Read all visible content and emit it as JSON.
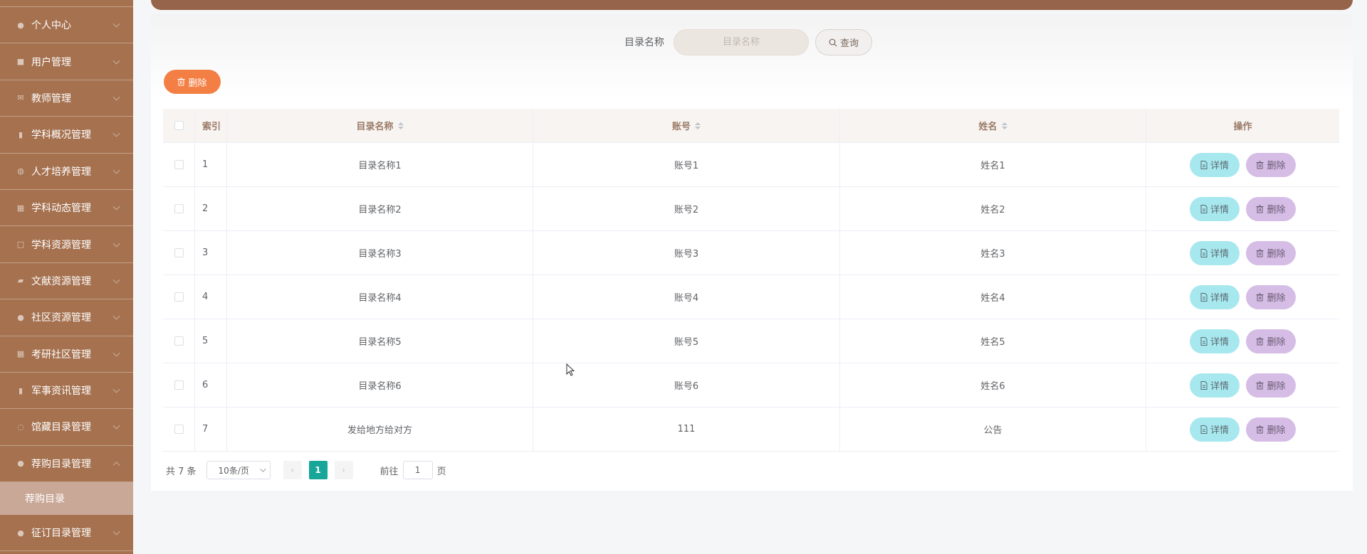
{
  "sidebar": {
    "items": [
      {
        "label": "个人中心",
        "icon": "user-icon"
      },
      {
        "label": "用户管理",
        "icon": "clipboard-icon"
      },
      {
        "label": "教师管理",
        "icon": "mail-icon"
      },
      {
        "label": "学科概况管理",
        "icon": "bar-chart-icon"
      },
      {
        "label": "人才培养管理",
        "icon": "globe-icon"
      },
      {
        "label": "学科动态管理",
        "icon": "grid-icon"
      },
      {
        "label": "学科资源管理",
        "icon": "square-icon"
      },
      {
        "label": "文献资源管理",
        "icon": "thumb-icon"
      },
      {
        "label": "社区资源管理",
        "icon": "person-icon"
      },
      {
        "label": "考研社区管理",
        "icon": "apps-icon"
      },
      {
        "label": "军事资讯管理",
        "icon": "chart-icon"
      },
      {
        "label": "馆藏目录管理",
        "icon": "power-icon"
      },
      {
        "label": "荐购目录管理",
        "icon": "location-icon"
      }
    ],
    "active_sub": "荐购目录",
    "last_item": {
      "label": "征订目录管理",
      "icon": "mic-icon"
    }
  },
  "search": {
    "label": "目录名称",
    "placeholder": "目录名称",
    "query_label": "查询"
  },
  "toolbar": {
    "delete_label": "删除"
  },
  "table": {
    "headers": {
      "index": "索引",
      "name": "目录名称",
      "account": "账号",
      "realname": "姓名",
      "op": "操作"
    },
    "rows": [
      {
        "index": "1",
        "name": "目录名称1",
        "account": "账号1",
        "realname": "姓名1"
      },
      {
        "index": "2",
        "name": "目录名称2",
        "account": "账号2",
        "realname": "姓名2"
      },
      {
        "index": "3",
        "name": "目录名称3",
        "account": "账号3",
        "realname": "姓名3"
      },
      {
        "index": "4",
        "name": "目录名称4",
        "account": "账号4",
        "realname": "姓名4"
      },
      {
        "index": "5",
        "name": "目录名称5",
        "account": "账号5",
        "realname": "姓名5"
      },
      {
        "index": "6",
        "name": "目录名称6",
        "account": "账号6",
        "realname": "姓名6"
      },
      {
        "index": "7",
        "name": "发给地方给对方",
        "account": "111",
        "realname": "公告"
      }
    ],
    "detail_label": "详情",
    "delete_label": "删除"
  },
  "pagination": {
    "total_text": "共 7 条",
    "page_size": "10条/页",
    "current_page": "1",
    "goto_prefix": "前往",
    "goto_value": "1",
    "goto_suffix": "页"
  },
  "colors": {
    "sidebar_bg": "#a5714f",
    "accent_orange": "#f47f44",
    "detail_cyan": "#a7e8ef",
    "delete_purple": "#d5bde6",
    "page_active": "#17a697"
  }
}
